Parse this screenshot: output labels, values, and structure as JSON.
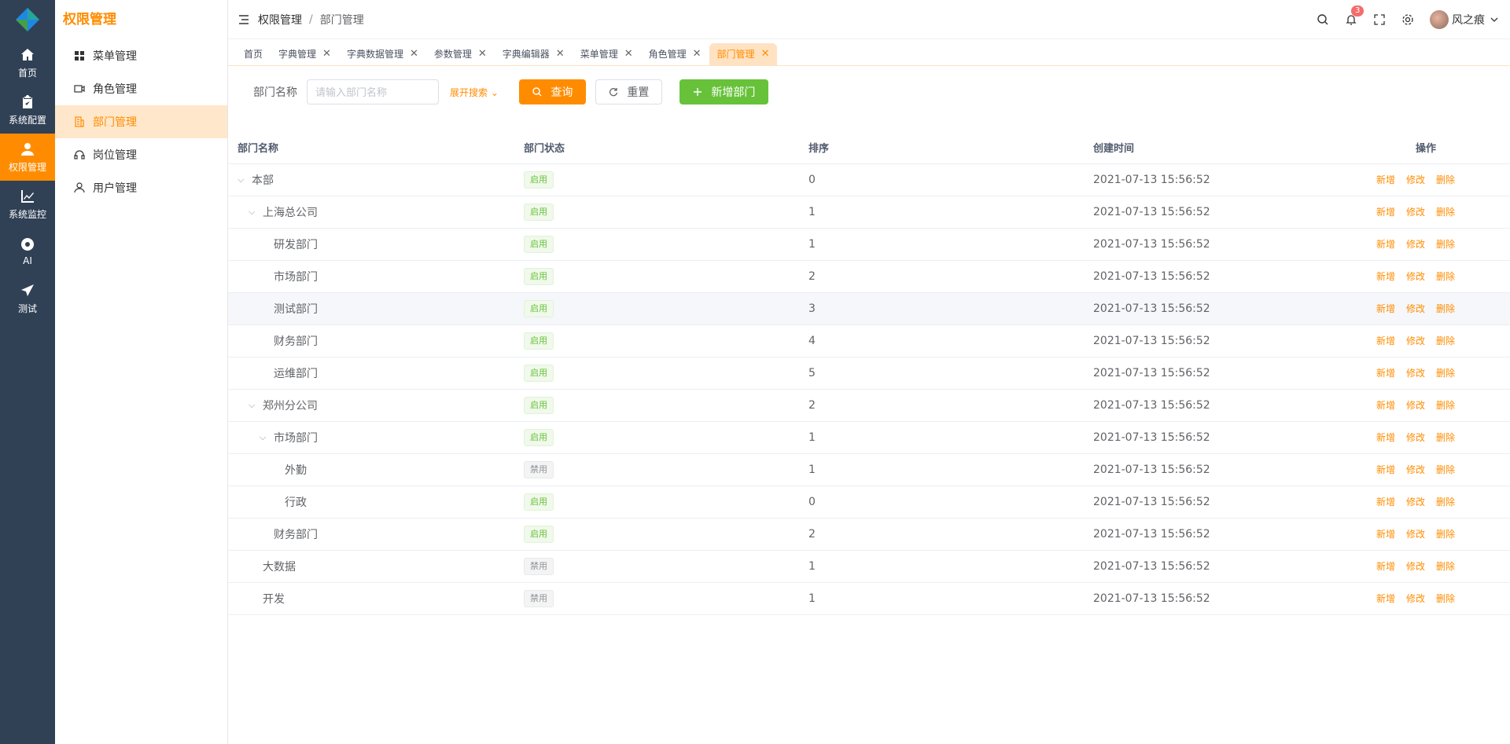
{
  "brand": {
    "title": "权限管理"
  },
  "rail": [
    {
      "label": "首页",
      "icon": "home-icon"
    },
    {
      "label": "系统配置",
      "icon": "clipboard-icon"
    },
    {
      "label": "权限管理",
      "icon": "user-icon",
      "active": true
    },
    {
      "label": "系统监控",
      "icon": "chart-icon"
    },
    {
      "label": "AI",
      "icon": "chrome-icon"
    },
    {
      "label": "测试",
      "icon": "send-icon"
    }
  ],
  "submenu": [
    {
      "label": "菜单管理",
      "icon": "grid-icon"
    },
    {
      "label": "角色管理",
      "icon": "video-icon"
    },
    {
      "label": "部门管理",
      "icon": "building-icon",
      "active": true
    },
    {
      "label": "岗位管理",
      "icon": "headset-icon"
    },
    {
      "label": "用户管理",
      "icon": "person-icon"
    }
  ],
  "breadcrumb": {
    "parent": "权限管理",
    "sep": "/",
    "current": "部门管理"
  },
  "header": {
    "notification_count": "3",
    "username": "风之痕"
  },
  "tabs": [
    {
      "label": "首页",
      "closable": false
    },
    {
      "label": "字典管理",
      "closable": true
    },
    {
      "label": "字典数据管理",
      "closable": true
    },
    {
      "label": "参数管理",
      "closable": true
    },
    {
      "label": "字典编辑器",
      "closable": true
    },
    {
      "label": "菜单管理",
      "closable": true
    },
    {
      "label": "角色管理",
      "closable": true
    },
    {
      "label": "部门管理",
      "closable": true,
      "active": true
    }
  ],
  "search": {
    "label": "部门名称",
    "placeholder": "请输入部门名称",
    "expand": "展开搜索",
    "query_btn": "查询",
    "reset_btn": "重置",
    "add_btn": "新增部门"
  },
  "table": {
    "headers": [
      "部门名称",
      "部门状态",
      "排序",
      "创建时间",
      "操作"
    ],
    "ops": [
      "新增",
      "修改",
      "删除"
    ],
    "rows": [
      {
        "name": "本部",
        "level": 0,
        "expand": true,
        "status": "启用",
        "on": true,
        "sort": "0",
        "time": "2021-07-13 15:56:52"
      },
      {
        "name": "上海总公司",
        "level": 1,
        "expand": true,
        "status": "启用",
        "on": true,
        "sort": "1",
        "time": "2021-07-13 15:56:52"
      },
      {
        "name": "研发部门",
        "level": 2,
        "expand": false,
        "status": "启用",
        "on": true,
        "sort": "1",
        "time": "2021-07-13 15:56:52"
      },
      {
        "name": "市场部门",
        "level": 2,
        "expand": false,
        "status": "启用",
        "on": true,
        "sort": "2",
        "time": "2021-07-13 15:56:52"
      },
      {
        "name": "测试部门",
        "level": 2,
        "expand": false,
        "status": "启用",
        "on": true,
        "sort": "3",
        "time": "2021-07-13 15:56:52",
        "hover": true
      },
      {
        "name": "财务部门",
        "level": 2,
        "expand": false,
        "status": "启用",
        "on": true,
        "sort": "4",
        "time": "2021-07-13 15:56:52"
      },
      {
        "name": "运维部门",
        "level": 2,
        "expand": false,
        "status": "启用",
        "on": true,
        "sort": "5",
        "time": "2021-07-13 15:56:52"
      },
      {
        "name": "郑州分公司",
        "level": 1,
        "expand": true,
        "status": "启用",
        "on": true,
        "sort": "2",
        "time": "2021-07-13 15:56:52"
      },
      {
        "name": "市场部门",
        "level": 2,
        "expand": true,
        "status": "启用",
        "on": true,
        "sort": "1",
        "time": "2021-07-13 15:56:52"
      },
      {
        "name": "外勤",
        "level": 3,
        "expand": false,
        "status": "禁用",
        "on": false,
        "sort": "1",
        "time": "2021-07-13 15:56:52"
      },
      {
        "name": "行政",
        "level": 3,
        "expand": false,
        "status": "启用",
        "on": true,
        "sort": "0",
        "time": "2021-07-13 15:56:52"
      },
      {
        "name": "财务部门",
        "level": 2,
        "expand": false,
        "status": "启用",
        "on": true,
        "sort": "2",
        "time": "2021-07-13 15:56:52"
      },
      {
        "name": "大数据",
        "level": 1,
        "expand": false,
        "status": "禁用",
        "on": false,
        "sort": "1",
        "time": "2021-07-13 15:56:52"
      },
      {
        "name": "开发",
        "level": 1,
        "expand": false,
        "status": "禁用",
        "on": false,
        "sort": "1",
        "time": "2021-07-13 15:56:52"
      }
    ]
  },
  "colors": {
    "accent": "#ff8c00",
    "rail": "#304156",
    "success": "#67c23a"
  }
}
